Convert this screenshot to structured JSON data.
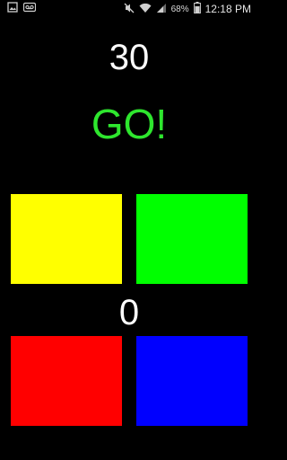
{
  "status_bar": {
    "battery": "68%",
    "time": "12:18 PM",
    "icons": [
      "image-icon",
      "voicemail-icon",
      "mute-icon",
      "wifi-icon",
      "signal-icon",
      "battery-icon"
    ]
  },
  "game": {
    "timer": "30",
    "status": "GO!",
    "score": "0",
    "status_color": "#2ee62e"
  },
  "pads": [
    {
      "name": "yellow",
      "color": "#ffff00"
    },
    {
      "name": "green",
      "color": "#00ff00"
    },
    {
      "name": "red",
      "color": "#ff0000"
    },
    {
      "name": "blue",
      "color": "#0000ff"
    }
  ]
}
